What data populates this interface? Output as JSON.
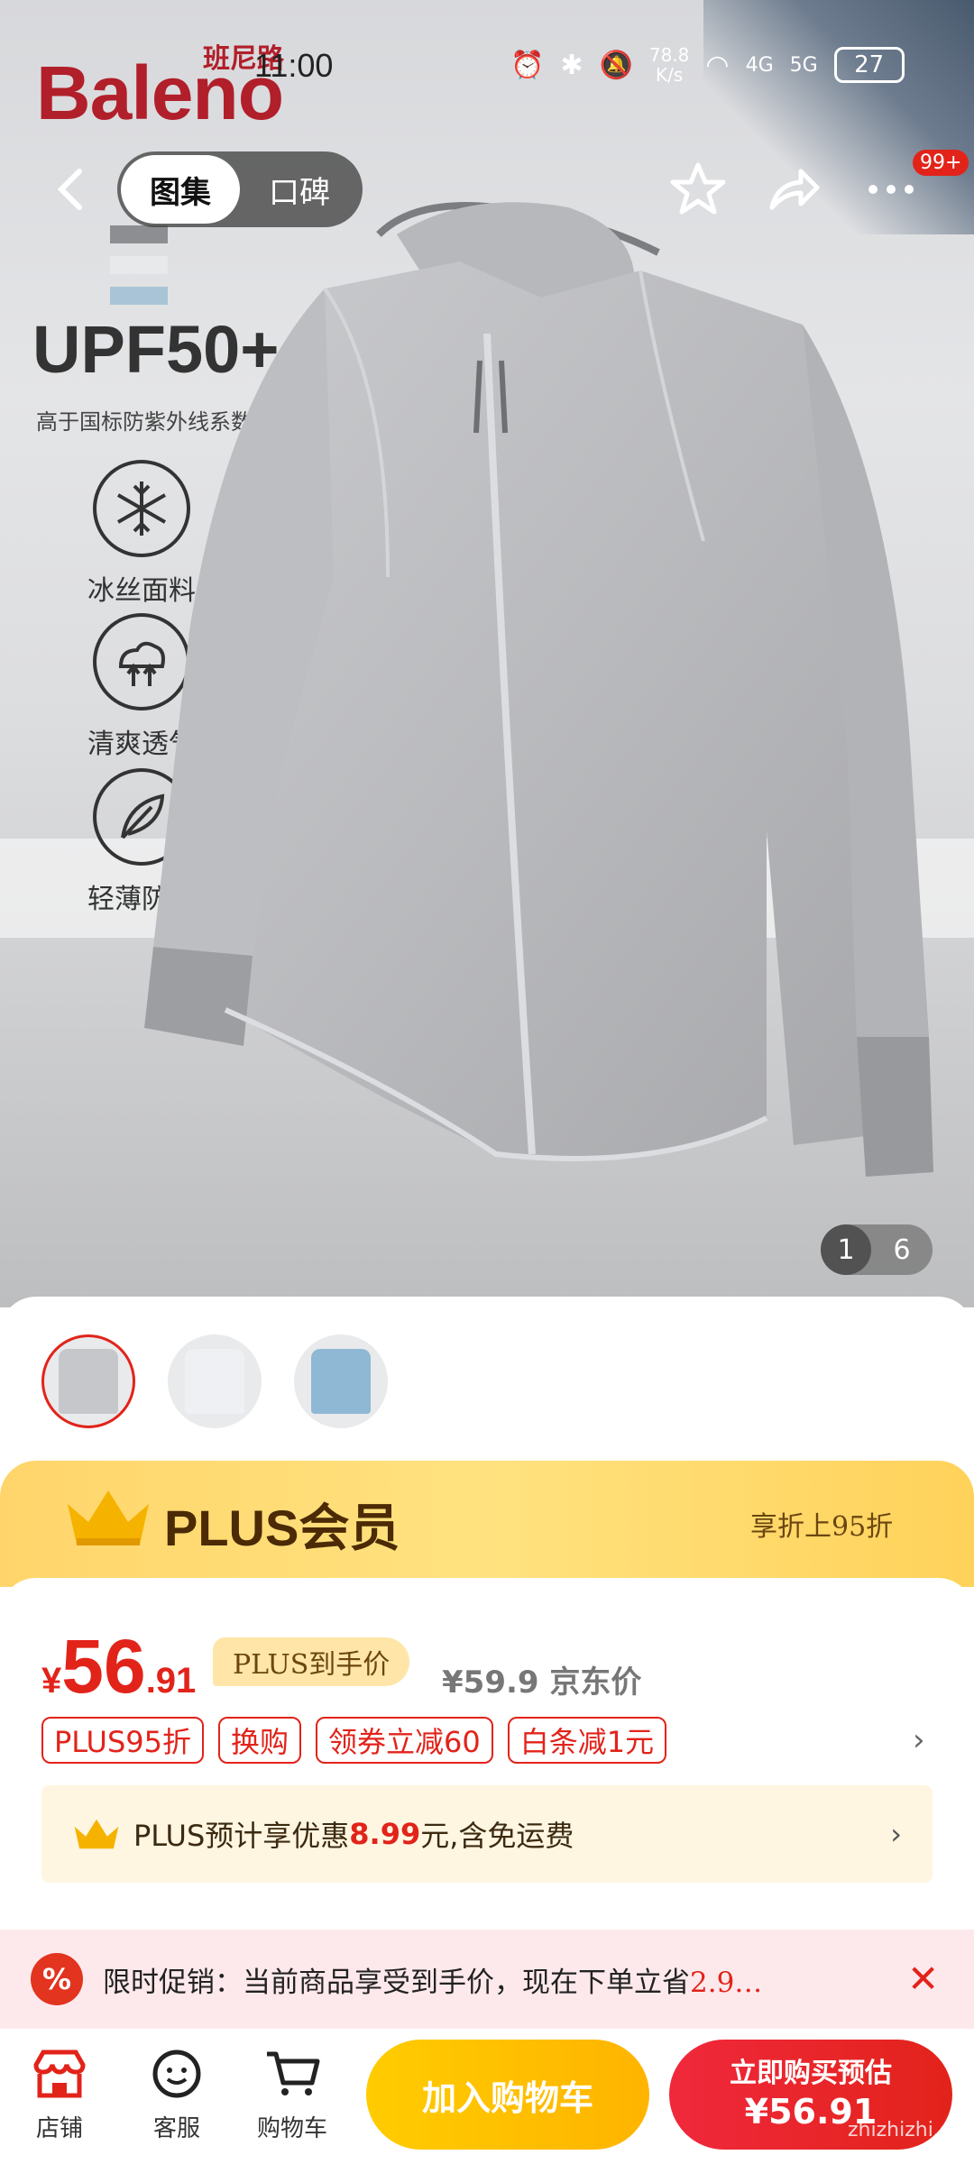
{
  "status_bar": {
    "time": "11:00",
    "net_speed_value": "78.8",
    "net_speed_unit": "K/s",
    "signal_1": "4G",
    "signal_2": "5G",
    "battery": "27"
  },
  "hero": {
    "brand": "Baleno",
    "brand_cn": "班尼路",
    "headline": "UPF50+",
    "headline_sub": "高于国标防紫外线系数",
    "features": [
      {
        "label": "冰丝面料",
        "icon": "snowflake-icon"
      },
      {
        "label": "清爽透气",
        "icon": "breathable-icon"
      },
      {
        "label": "轻薄防晒",
        "icon": "feather-icon"
      }
    ],
    "page_current": "1",
    "page_total": "6"
  },
  "nav": {
    "tabs": [
      "图集",
      "口碑"
    ],
    "badge": "99+"
  },
  "thumbnails": [
    "#dfe0e2",
    "#eef0f3",
    "#8fb8d4"
  ],
  "plus": {
    "title": "PLUS会员",
    "right": "享折上95折"
  },
  "price": {
    "symbol": "¥",
    "integer": "56",
    "decimal": ".91",
    "tag": "PLUS到手价",
    "jd_price": "¥59.9 京东价"
  },
  "promos": [
    "PLUS95折",
    "换购",
    "领券立减60",
    "白条减1元"
  ],
  "plus_estimate": {
    "prefix": "PLUS预计享优惠",
    "amount": "8.99",
    "suffix": "元,含免运费"
  },
  "promo_strip": {
    "icon": "%",
    "text_prefix": "限时促销：当前商品享受到手价，现在下单立省",
    "text_amount": "2.9…"
  },
  "bottom_bar": {
    "store": "店铺",
    "service": "客服",
    "cart": "购物车",
    "add_cart": "加入购物车",
    "buy_line1": "立即购买预估",
    "buy_line2": "¥56.91"
  },
  "watermark": "zhizhizhi.com",
  "colors": {
    "accent_red": "#e2231a",
    "plus_gold": "#ffd56b",
    "cart_yellow": "#ffcc00"
  }
}
